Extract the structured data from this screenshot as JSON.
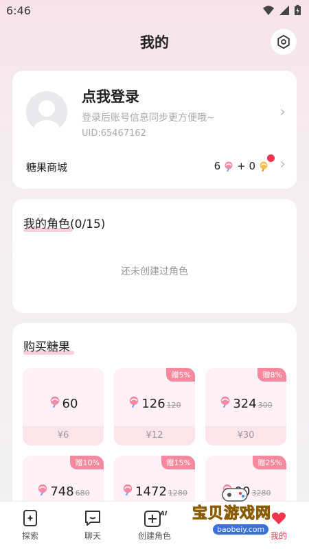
{
  "status_bar": {
    "time": "6:46"
  },
  "header": {
    "title": "我的"
  },
  "profile": {
    "login_title": "点我登录",
    "login_sub": "登录后账号信息同步更方便哦~",
    "uid": "UID:65467162",
    "candy_shop": "糖果商城",
    "candy_count": "6",
    "plus": "+ 0"
  },
  "roles": {
    "title": "我的角色(0/15)",
    "empty": "还未创建过角色"
  },
  "buy": {
    "title": "购买糖果",
    "packages": [
      {
        "amount": "60",
        "original": "",
        "price": "¥6",
        "bonus": ""
      },
      {
        "amount": "126",
        "original": "120",
        "price": "¥12",
        "bonus": "赠5%"
      },
      {
        "amount": "324",
        "original": "300",
        "price": "¥30",
        "bonus": "赠8%"
      },
      {
        "amount": "748",
        "original": "680",
        "price": "",
        "bonus": "赠10%"
      },
      {
        "amount": "1472",
        "original": "1280",
        "price": "",
        "bonus": "赠15%"
      },
      {
        "amount": "00",
        "original": "3280",
        "price": "",
        "bonus": "赠25%"
      }
    ]
  },
  "tabs": [
    {
      "label": "探索"
    },
    {
      "label": "聊天"
    },
    {
      "label": "创建角色"
    },
    {
      "label": "我的"
    }
  ],
  "watermark": {
    "text": "宝贝游戏网",
    "url": "baobeiy.com"
  },
  "colors": {
    "accent": "#f2344d",
    "badge": "#f7899f",
    "package_bg": "#fff1f5"
  }
}
